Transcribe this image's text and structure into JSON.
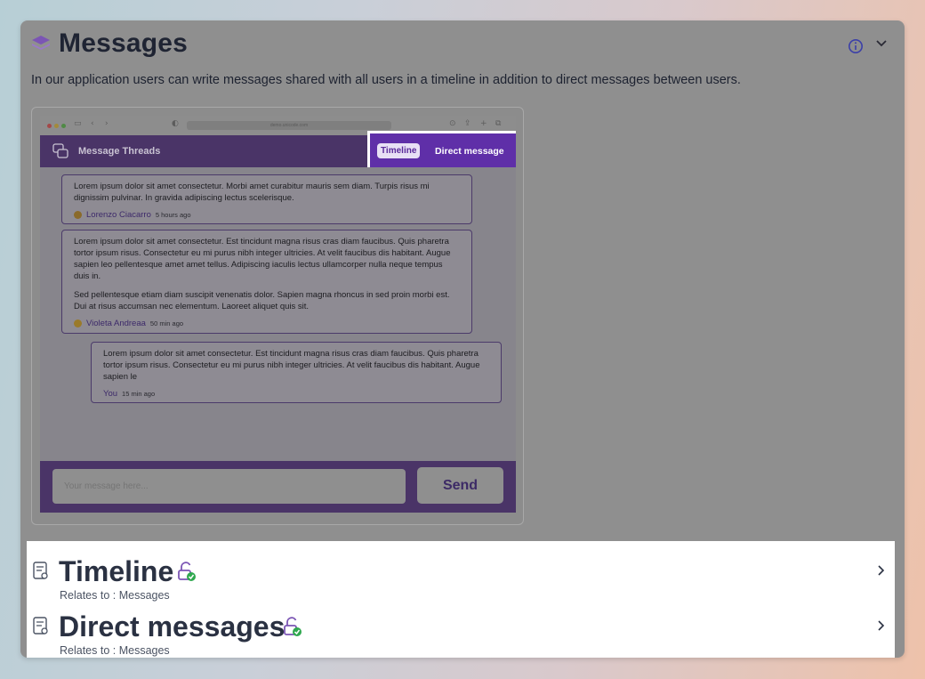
{
  "header": {
    "title": "Messages",
    "icon": "layers-icon",
    "description": "In our application users can write messages shared with all users in a timeline in addition to direct messages between users."
  },
  "screenshot": {
    "url": "demo.unicode.com",
    "app_title": "Message Threads",
    "tabs": {
      "timeline": "Timeline",
      "direct": "Direct message"
    },
    "messages": [
      {
        "paragraphs": [
          "Lorem ipsum dolor sit amet consectetur. Morbi amet curabitur mauris sem diam. Turpis risus mi dignissim pulvinar. In gravida adipiscing lectus scelerisque."
        ],
        "author": "Lorenzo Ciacarro",
        "time": "5 hours ago"
      },
      {
        "paragraphs": [
          "Lorem ipsum dolor sit amet consectetur. Est tincidunt magna risus cras diam faucibus. Quis pharetra tortor ipsum risus. Consectetur eu mi purus nibh integer ultricies. At velit faucibus dis habitant. Augue sapien leo pellentesque amet amet tellus. Adipiscing iaculis lectus ullamcorper nulla neque tempus duis in.",
          "Sed pellentesque etiam diam suscipit venenatis dolor. Sapien magna rhoncus in sed proin morbi est. Dui at risus accumsan nec elementum. Laoreet aliquet quis sit."
        ],
        "author": "Violeta Andreaa",
        "time": "50 min ago"
      },
      {
        "paragraphs": [
          "Lorem ipsum dolor sit amet consectetur. Est tincidunt magna risus cras diam faucibus. Quis pharetra tortor ipsum risus. Consectetur eu mi purus nibh integer ultricies. At velit faucibus dis habitant. Augue sapien le"
        ],
        "author": "You",
        "time": "15 min ago"
      }
    ],
    "input_placeholder": "Your message here...",
    "send_label": "Send"
  },
  "related": [
    {
      "title": "Timeline",
      "relates_to": "Relates to : Messages"
    },
    {
      "title": "Direct messages",
      "relates_to": "Relates to : Messages"
    }
  ],
  "colors": {
    "accent": "#5f2fa8",
    "unlock_check": "#2fa84f",
    "title_text": "#1f2433"
  }
}
